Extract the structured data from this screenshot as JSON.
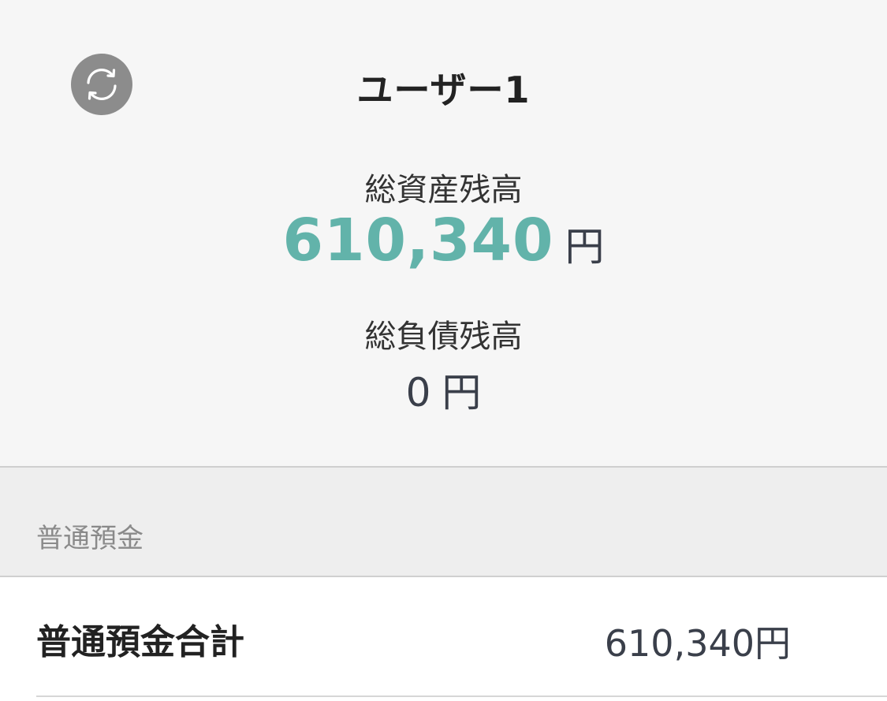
{
  "header": {
    "user_name": "ユーザー1",
    "refresh_icon": "refresh-icon"
  },
  "summary": {
    "asset_label": "総資産残高",
    "asset_value": "610,340",
    "asset_unit": "円",
    "liability_label": "総負債残高",
    "liability_value": "0",
    "liability_unit": "円"
  },
  "section": {
    "title": "普通預金"
  },
  "total": {
    "label": "普通預金合計",
    "value": "610,340円"
  },
  "colors": {
    "accent": "#62b3aa",
    "icon_bg": "#8c8c8c",
    "summary_bg": "#f6f6f6",
    "section_bg": "#eeeeee"
  }
}
